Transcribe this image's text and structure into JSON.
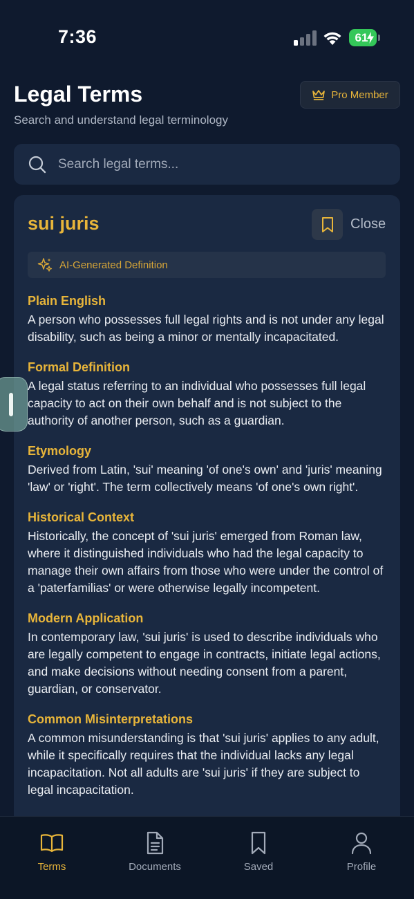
{
  "status_bar": {
    "time": "7:36",
    "battery": "61"
  },
  "header": {
    "title": "Legal Terms",
    "subtitle": "Search and understand legal terminology",
    "pro_badge": "Pro Member"
  },
  "search": {
    "placeholder": "Search legal terms..."
  },
  "definition": {
    "term": "sui juris",
    "close_label": "Close",
    "ai_badge": "AI-Generated Definition",
    "sections": [
      {
        "heading": "Plain English",
        "body": "A person who possesses full legal rights and is not under any legal disability, such as being a minor or mentally incapacitated."
      },
      {
        "heading": "Formal Definition",
        "body": "A legal status referring to an individual who possesses full legal capacity to act on their own behalf and is not subject to the authority of another person, such as a guardian."
      },
      {
        "heading": "Etymology",
        "body": "Derived from Latin, 'sui' meaning 'of one's own' and 'juris' meaning 'law' or 'right'. The term collectively means 'of one's own right'."
      },
      {
        "heading": "Historical Context",
        "body": "Historically, the concept of 'sui juris' emerged from Roman law, where it distinguished individuals who had the legal capacity to manage their own affairs from those who were under the control of a 'paterfamilias' or were otherwise legally incompetent."
      },
      {
        "heading": "Modern Application",
        "body": "In contemporary law, 'sui juris' is used to describe individuals who are legally competent to engage in contracts, initiate legal actions, and make decisions without needing consent from a parent, guardian, or conservator."
      },
      {
        "heading": "Common Misinterpretations",
        "body": "A common misunderstanding is that 'sui juris' applies to any adult, while it specifically requires that the individual lacks any legal incapacitation. Not all adults are 'sui juris' if they are subject to legal incapacitation."
      }
    ]
  },
  "tabs": [
    {
      "label": "Terms",
      "icon": "book-open-icon",
      "active": true
    },
    {
      "label": "Documents",
      "icon": "document-icon",
      "active": false
    },
    {
      "label": "Saved",
      "icon": "bookmark-icon",
      "active": false
    },
    {
      "label": "Profile",
      "icon": "user-icon",
      "active": false
    }
  ],
  "colors": {
    "accent": "#e8b53a",
    "background": "#0f1a2e",
    "card": "#1a2942"
  }
}
